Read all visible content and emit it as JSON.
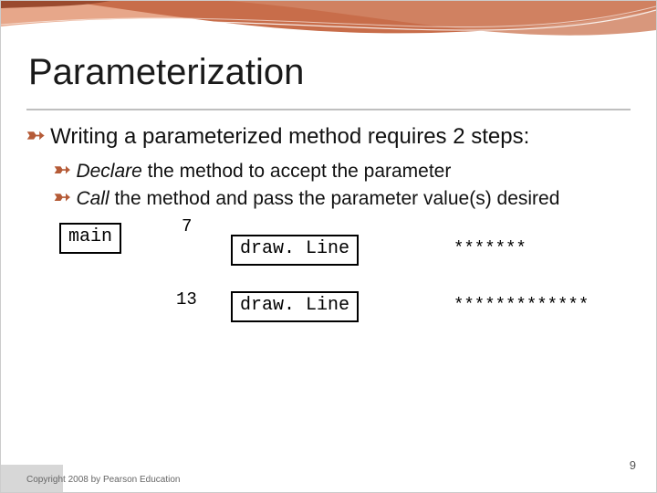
{
  "title": "Parameterization",
  "bullet1": "Writing a parameterized method requires 2 steps:",
  "sub1_em": "Declare",
  "sub1_rest": " the method to accept the parameter",
  "sub2_em": "Call",
  "sub2_rest": " the method and pass the parameter value(s) desired",
  "diagram": {
    "main_label": "main",
    "call1_arg": "7",
    "call1_box": "draw. Line",
    "call1_out": "*******",
    "call2_arg": "13",
    "call2_box": "draw. Line",
    "call2_out": "*************"
  },
  "footer": "Copyright 2008 by Pearson Education",
  "page_number": "9"
}
